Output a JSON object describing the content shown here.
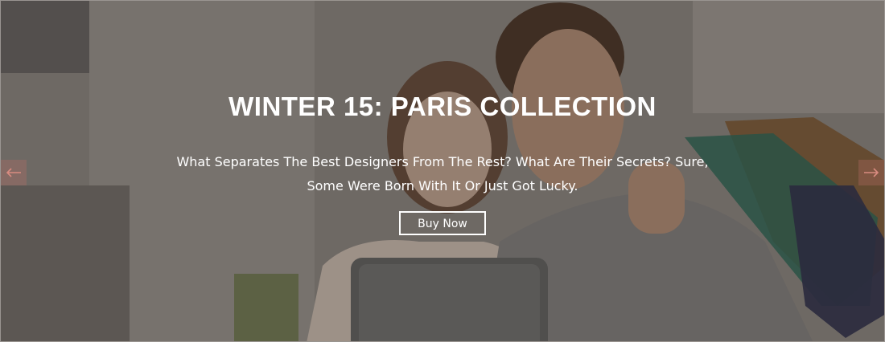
{
  "slide": {
    "title": "WINTER 15: PARIS COLLECTION",
    "description_line1": "What Separates The Best Designers From The Rest? What Are Their Secrets? Sure,",
    "description_line2": "Some Were Born With It Or Just Got Lucky.",
    "button_label": "Buy Now"
  },
  "controls": {
    "prev_icon": "arrow-left-icon",
    "next_icon": "arrow-right-icon"
  },
  "colors": {
    "overlay_text": "#ffffff",
    "arrow_bg": "#b46e64"
  }
}
